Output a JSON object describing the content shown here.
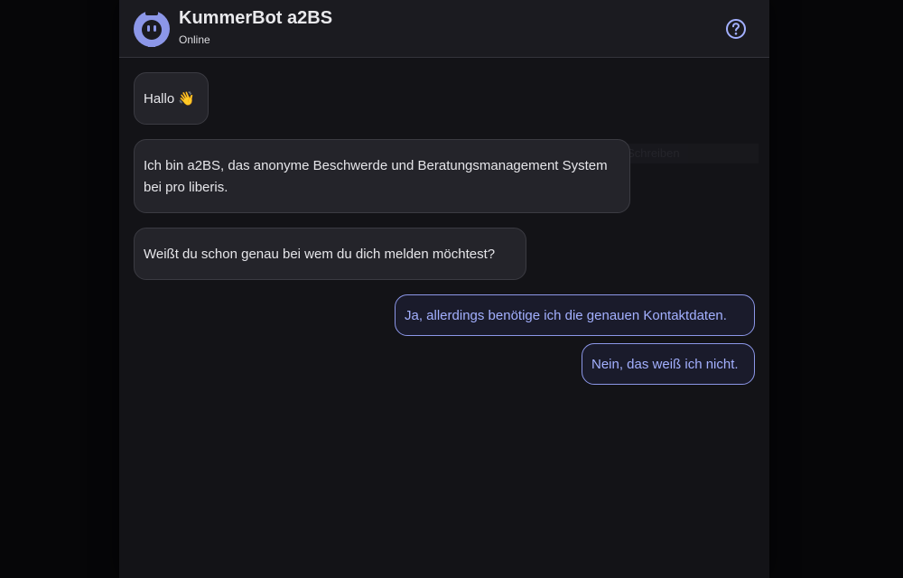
{
  "header": {
    "title": "KummerBot a2BS",
    "status": "Online",
    "avatar_icon": "robot-icon",
    "help_icon": "help-circle-icon"
  },
  "messages": [
    {
      "sender": "bot",
      "text": "Hallo 👋"
    },
    {
      "sender": "bot",
      "text": "Ich bin a2BS, das anonyme Beschwerde und Beratungsmanagement System bei pro liberis."
    },
    {
      "sender": "bot",
      "text": "Weißt du schon genau bei wem du dich melden möchtest?"
    },
    {
      "sender": "user",
      "text": "Ja, allerdings benötige ich die genauen Kontaktdaten."
    },
    {
      "sender": "user",
      "text": "Nein, das weiß ich nicht."
    }
  ],
  "ghost_strip": {
    "text": "Zeitpunkt Schreiben"
  },
  "colors": {
    "accent": "#8c97e8",
    "user_text": "#a3b0ff",
    "page_bg": "#060608",
    "panel_bg": "#131317",
    "header_bg": "#1b1b20",
    "bot_bubble_bg": "#24242a"
  }
}
